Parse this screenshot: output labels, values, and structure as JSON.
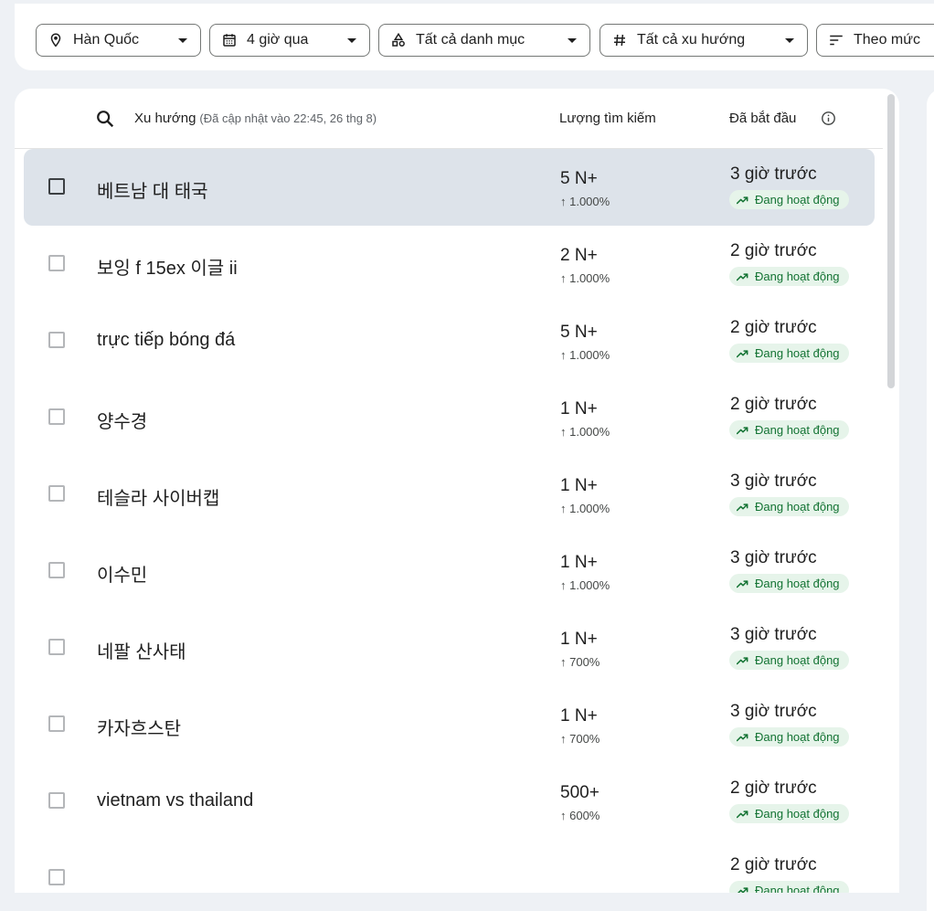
{
  "filters": [
    {
      "icon": "location-pin-icon",
      "label": "Hàn Quốc"
    },
    {
      "icon": "calendar-icon",
      "label": "4 giờ qua"
    },
    {
      "icon": "category-shapes-icon",
      "label": "Tất cả danh mục"
    },
    {
      "icon": "hashtag-icon",
      "label": "Tất cả xu hướng"
    },
    {
      "icon": "sort-icon",
      "label": "Theo mức"
    }
  ],
  "table": {
    "header": {
      "trend": "Xu hướng",
      "updated": "(Đã cập nhật vào 22:45, 26 thg 8)",
      "volume": "Lượng tìm kiếm",
      "started": "Đã bắt đầu"
    },
    "status_label": "Đang hoạt động",
    "rows": [
      {
        "term": "베트남 대 태국",
        "volume": "5 N+",
        "pct": "↑ 1.000%",
        "started": "3 giờ trước",
        "selected": true
      },
      {
        "term": "보잉 f 15ex 이글 ii",
        "volume": "2 N+",
        "pct": "↑ 1.000%",
        "started": "2 giờ trước"
      },
      {
        "term": "trực tiếp bóng đá",
        "volume": "5 N+",
        "pct": "↑ 1.000%",
        "started": "2 giờ trước"
      },
      {
        "term": "양수경",
        "volume": "1 N+",
        "pct": "↑ 1.000%",
        "started": "2 giờ trước"
      },
      {
        "term": "테슬라 사이버캡",
        "volume": "1 N+",
        "pct": "↑ 1.000%",
        "started": "3 giờ trước"
      },
      {
        "term": "이수민",
        "volume": "1 N+",
        "pct": "↑ 1.000%",
        "started": "3 giờ trước"
      },
      {
        "term": "네팔 산사태",
        "volume": "1 N+",
        "pct": "↑ 700%",
        "started": "3 giờ trước"
      },
      {
        "term": "카자흐스탄",
        "volume": "1 N+",
        "pct": "↑ 700%",
        "started": "3 giờ trước"
      },
      {
        "term": "vietnam vs thailand",
        "volume": "500+",
        "pct": "↑ 600%",
        "started": "2 giờ trước"
      },
      {
        "term": "",
        "volume": "",
        "pct": "",
        "started": "2 giờ trước"
      }
    ]
  },
  "colors": {
    "selected_row": "#dde3ea",
    "badge_bg": "#e6f4ea",
    "badge_text": "#137333"
  }
}
